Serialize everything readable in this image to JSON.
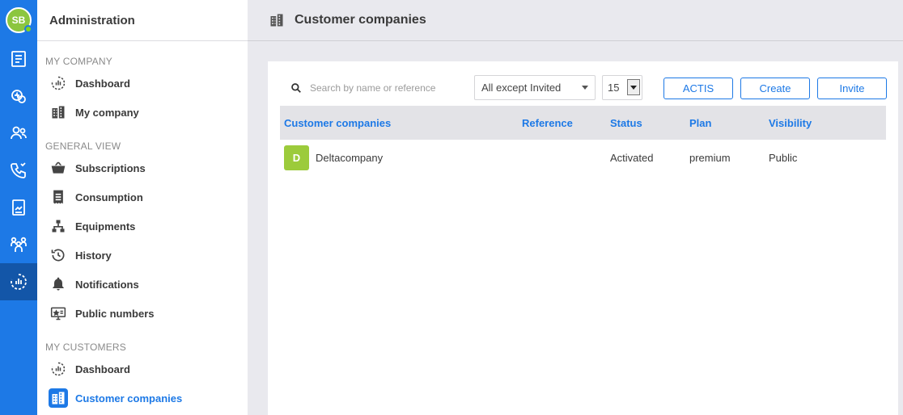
{
  "user": {
    "initials": "SB"
  },
  "rail": {
    "items": [
      {
        "icon": "news-icon"
      },
      {
        "icon": "network-icon"
      },
      {
        "icon": "users-icon"
      },
      {
        "icon": "phone-icon"
      },
      {
        "icon": "document-icon"
      },
      {
        "icon": "groups-icon"
      },
      {
        "icon": "admin-dashboard-icon",
        "active": true
      }
    ]
  },
  "sidebar": {
    "title": "Administration",
    "sections": [
      {
        "label": "MY COMPANY",
        "items": [
          {
            "label": "Dashboard",
            "icon": "dashboard-icon"
          },
          {
            "label": "My company",
            "icon": "building-icon"
          }
        ]
      },
      {
        "label": "GENERAL VIEW",
        "items": [
          {
            "label": "Subscriptions",
            "icon": "basket-icon"
          },
          {
            "label": "Consumption",
            "icon": "receipt-icon"
          },
          {
            "label": "Equipments",
            "icon": "hierarchy-icon"
          },
          {
            "label": "History",
            "icon": "history-icon"
          },
          {
            "label": "Notifications",
            "icon": "bell-icon"
          },
          {
            "label": "Public numbers",
            "icon": "public-number-icon"
          }
        ]
      },
      {
        "label": "MY CUSTOMERS",
        "items": [
          {
            "label": "Dashboard",
            "icon": "dashboard-icon"
          },
          {
            "label": "Customer companies",
            "icon": "building-icon",
            "active": true
          }
        ]
      }
    ]
  },
  "page": {
    "title": "Customer companies"
  },
  "toolbar": {
    "search_placeholder": "Search by name or reference",
    "filter_value": "All except Invited",
    "page_size": "15",
    "buttons": {
      "actis": "ACTIS",
      "create": "Create",
      "invite": "Invite"
    }
  },
  "table": {
    "headers": [
      "Customer companies",
      "Reference",
      "Status",
      "Plan",
      "Visibility"
    ],
    "rows": [
      {
        "initial": "D",
        "name": "Deltacompany",
        "reference": "",
        "status": "Activated",
        "plan": "premium",
        "visibility": "Public"
      }
    ]
  },
  "colors": {
    "accent": "#1d79e6",
    "rail_active": "#1356a8",
    "avatar": "#8cc63f",
    "badge": "#9ccb3b"
  }
}
